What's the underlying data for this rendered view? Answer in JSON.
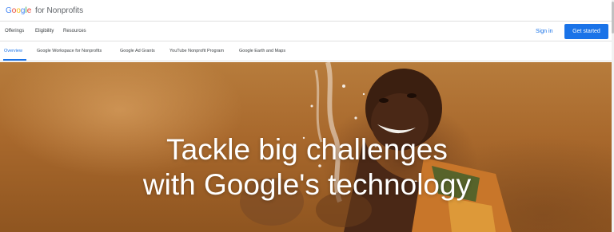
{
  "brand": {
    "letters": [
      "G",
      "o",
      "o",
      "g",
      "l",
      "e"
    ],
    "suffix": "for Nonprofits",
    "colors": {
      "blue": "#4285f4",
      "red": "#ea4335",
      "yellow": "#fbbc05",
      "green": "#34a853"
    }
  },
  "nav": {
    "items": [
      {
        "label": "Offerings"
      },
      {
        "label": "Eligibility"
      },
      {
        "label": "Resources"
      }
    ],
    "sign_in": "Sign in",
    "cta": "Get started"
  },
  "subnav": {
    "tabs": [
      {
        "label": "Overview",
        "active": true
      },
      {
        "label": "Google Workspace for Nonprofits",
        "active": false
      },
      {
        "label": "Google Ad Grants",
        "active": false
      },
      {
        "label": "YouTube Nonprofit Program",
        "active": false
      },
      {
        "label": "Google Earth and Maps",
        "active": false
      }
    ]
  },
  "hero": {
    "title_line1": "Tackle big challenges",
    "title_line2": "with Google's technology"
  },
  "colors": {
    "accent": "#1a73e8",
    "text": "#3c4043"
  }
}
